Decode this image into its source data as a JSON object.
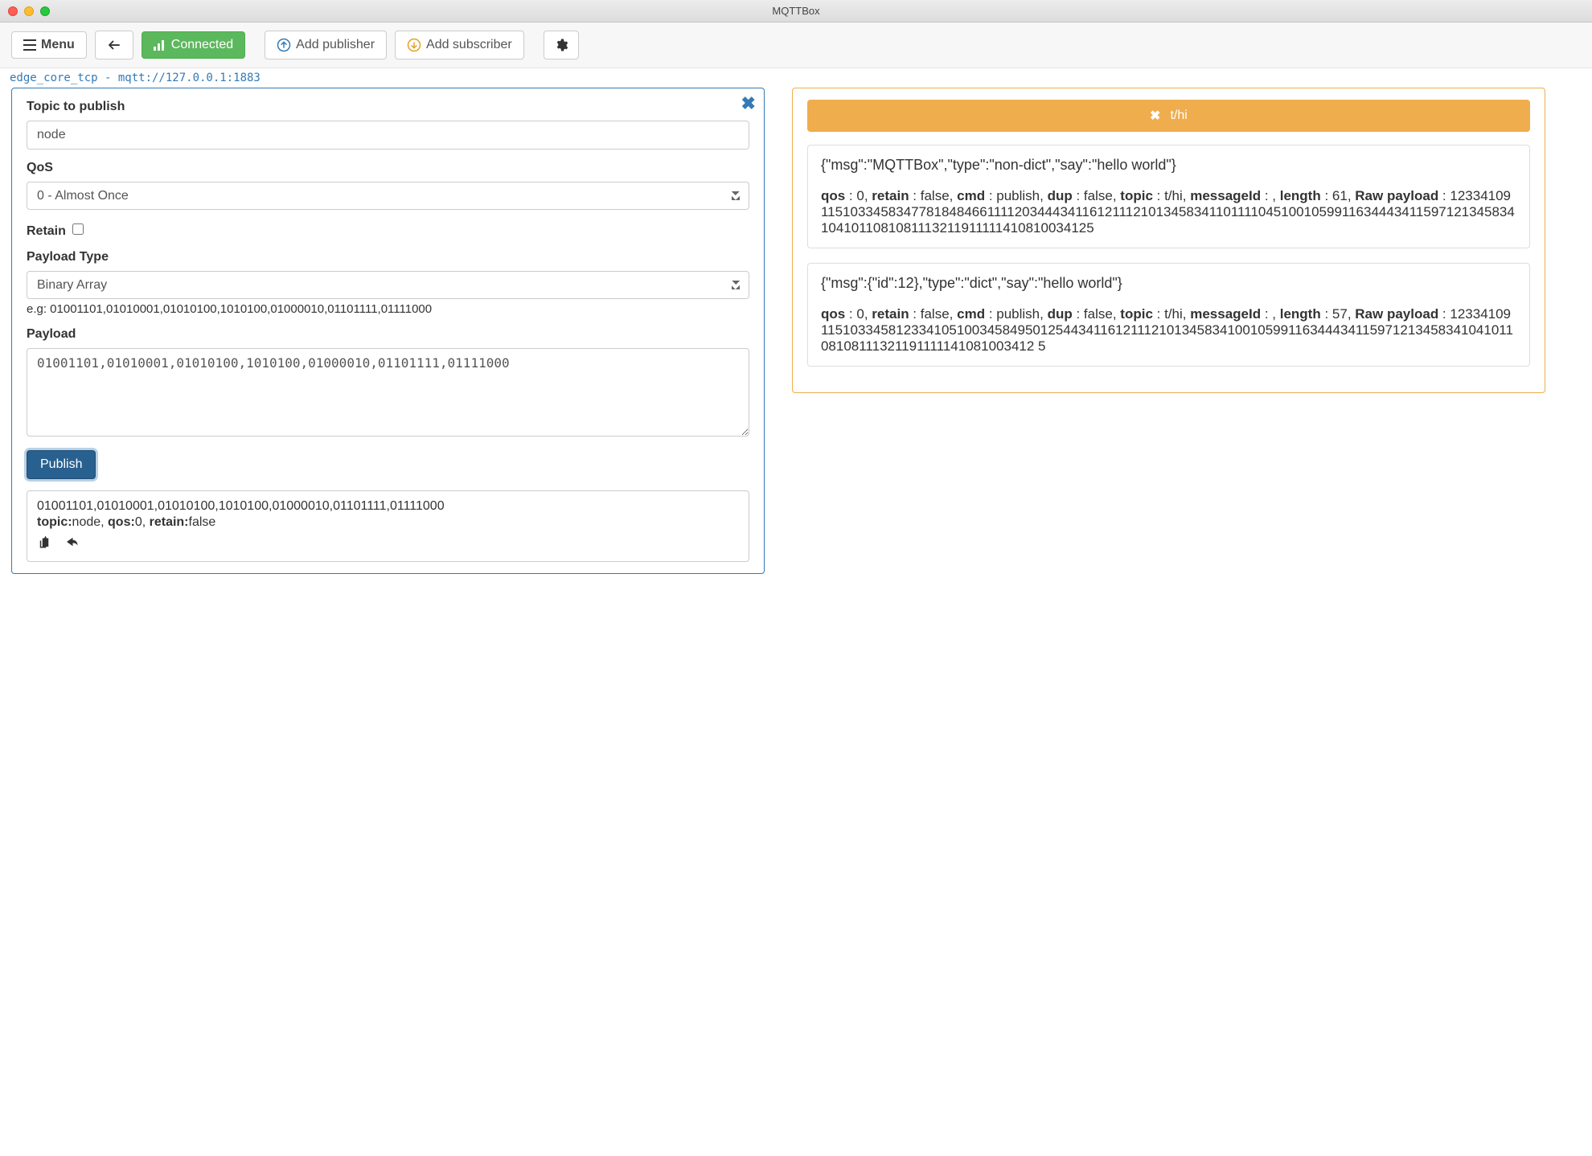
{
  "window": {
    "title": "MQTTBox"
  },
  "toolbar": {
    "menu": "Menu",
    "connected": "Connected",
    "add_publisher": "Add publisher",
    "add_subscriber": "Add subscriber"
  },
  "tab": {
    "label": "edge_core_tcp - mqtt://127.0.0.1:1883"
  },
  "publisher": {
    "topic_label": "Topic to publish",
    "topic_value": "node",
    "qos_label": "QoS",
    "qos_value": "0 - Almost Once",
    "retain_label": "Retain",
    "payload_type_label": "Payload Type",
    "payload_type_value": "Binary Array",
    "payload_type_hint": "e.g: 01001101,01010001,01010100,1010100,01000010,01101111,01111000",
    "payload_label": "Payload",
    "payload_value": "01001101,01010001,01010100,1010100,01000010,01101111,01111000",
    "publish_btn": "Publish",
    "sent": {
      "payload": "01001101,01010001,01010100,1010100,01000010,01101111,01111000",
      "topic_label": "topic:",
      "topic_value": "node",
      "qos_label": "qos:",
      "qos_value": "0",
      "retain_label": "retain:",
      "retain_value": "false"
    }
  },
  "subscriber": {
    "topic": "t/hi",
    "messages": [
      {
        "body": "{\"msg\":\"MQTTBox\",\"type\":\"non-dict\",\"say\":\"hello world\"}",
        "qos": "0",
        "retain": "false",
        "cmd": "publish",
        "dup": "false",
        "topic": "t/hi",
        "messageId": "",
        "length": "61",
        "raw": "123341091151033458347781848466111120344434116121112101345834110111104510010599116344434115971213458341041011081081113211911111410810034125"
      },
      {
        "body": "{\"msg\":{\"id\":12},\"type\":\"dict\",\"say\":\"hello world\"}",
        "qos": "0",
        "retain": "false",
        "cmd": "publish",
        "dup": "false",
        "topic": "t/hi",
        "messageId": "",
        "length": "57",
        "raw": "123341091151033458123341051003458495012544341161211121013458341001059911634443411597121345834104101108108111321191111141081003412 5"
      }
    ]
  }
}
